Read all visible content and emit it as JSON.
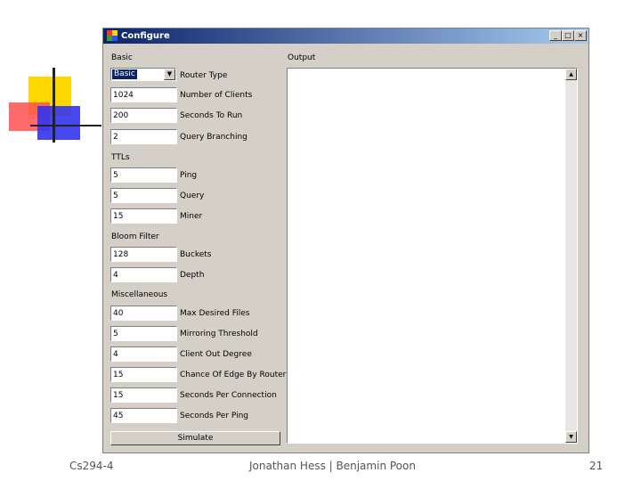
{
  "window": {
    "title": "Configure",
    "controls": {
      "minimize": "_",
      "maximize": "□",
      "close": "×"
    }
  },
  "basic": {
    "header": "Basic",
    "router_type": {
      "value": "Basic",
      "label": "Router Type"
    },
    "number_of_clients": {
      "value": "1024",
      "label": "Number of Clients"
    },
    "seconds_to_run": {
      "value": "200",
      "label": "Seconds To Run"
    },
    "query_branching": {
      "value": "2",
      "label": "Query Branching"
    }
  },
  "ttls": {
    "header": "TTLs",
    "ping": {
      "value": "5",
      "label": "Ping"
    },
    "query": {
      "value": "5",
      "label": "Query"
    },
    "miner": {
      "value": "15",
      "label": "Miner"
    }
  },
  "bloom_filter": {
    "header": "Bloom Filter",
    "buckets": {
      "value": "128",
      "label": "Buckets"
    },
    "depth": {
      "value": "4",
      "label": "Depth"
    }
  },
  "miscellaneous": {
    "header": "Miscellaneous",
    "max_desired_files": {
      "value": "40",
      "label": "Max Desired Files"
    },
    "mirroring_threshold": {
      "value": "5",
      "label": "Mirroring Threshold"
    },
    "client_out_degree": {
      "value": "4",
      "label": "Client Out Degree"
    },
    "chance_of_edge_by_router": {
      "value": "15",
      "label": "Chance Of Edge By Router"
    },
    "seconds_per_connection": {
      "value": "15",
      "label": "Seconds Per Connection"
    },
    "seconds_per_ping": {
      "value": "45",
      "label": "Seconds Per Ping"
    }
  },
  "simulate_label": "Simulate",
  "output": {
    "header": "Output"
  },
  "footer": {
    "left": "Cs294-4",
    "center": "Jonathan Hess | Benjamin Poon",
    "right": "21"
  },
  "colors": {
    "titlebar_start": "#0a246a",
    "titlebar_end": "#a6caf0",
    "window_bg": "#d4d0c8",
    "deco_yellow": "#ffd700",
    "deco_red": "#ff4040",
    "deco_blue": "#3333ee"
  }
}
